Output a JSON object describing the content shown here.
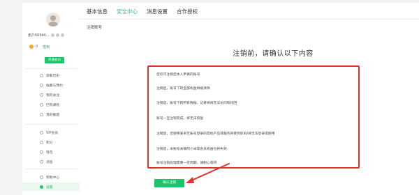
{
  "user": {
    "username": "用户669b0...",
    "coins": "0",
    "coin_link": "签到"
  },
  "sidebar": {
    "vip_button": "开通会员",
    "group1": [
      {
        "label": "观看历史"
      },
      {
        "label": "收藏与预约"
      },
      {
        "label": "我的关注"
      },
      {
        "label": "已购课程"
      },
      {
        "label": "我的截图"
      }
    ],
    "group2": [
      {
        "label": "VIP会员"
      },
      {
        "label": "积分"
      },
      {
        "label": "钱包"
      },
      {
        "label": "消息"
      }
    ],
    "group3": [
      {
        "label": "帮助中心"
      },
      {
        "label": "设置"
      }
    ]
  },
  "header": {
    "tabs": [
      {
        "label": "基本信息"
      },
      {
        "label": "安全中心"
      },
      {
        "label": "消息设置"
      },
      {
        "label": "合作授权"
      }
    ],
    "active_tab": 1
  },
  "main": {
    "subtitle": "注销账号",
    "notice_title": "注销前，请确认以下内容",
    "notices": [
      "您仅可注销您本人申请的账号",
      "注销后，账号下的全部权益将被清除",
      "注销后，账号下的所有数据、记录将将无法访问和找回",
      "账号一旦注销完成，将无法恢复",
      "注销后，您使用爱奇艺账号登录的其他产品或服务将受到影响/将无法登录或使用",
      "注销后，本账号关联的小米等会员权益也将失效",
      "账号注销处理需要一定周期，请耐心等待"
    ],
    "confirm_button": "确认注销"
  },
  "colors": {
    "accent": "#1ec36b",
    "highlight_border": "#e0312c"
  }
}
